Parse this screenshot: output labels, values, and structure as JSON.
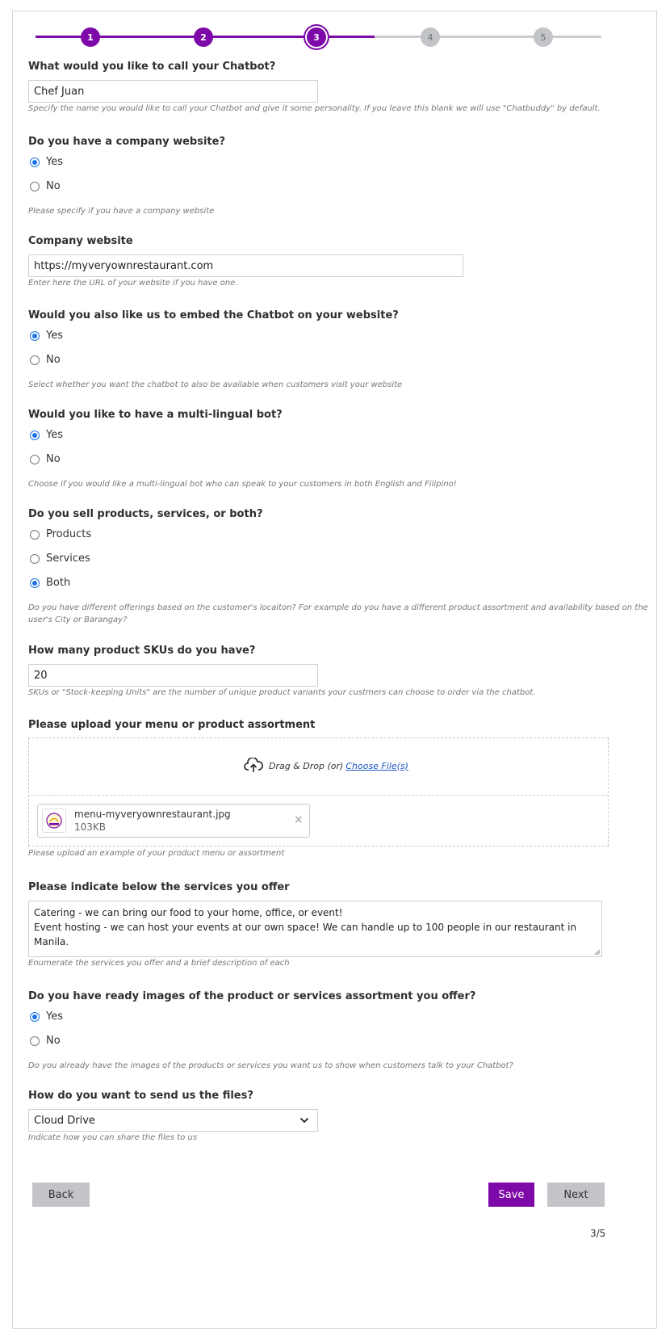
{
  "colors": {
    "accent": "#7d0aa8",
    "radio": "#1a73e8",
    "grey_button": "#c2c4c8"
  },
  "stepper": {
    "steps": [
      "1",
      "2",
      "3",
      "4",
      "5"
    ],
    "current": 3
  },
  "chatbot_name": {
    "label": "What would you like to call your Chatbot?",
    "value": "Chef Juan",
    "help": "Specify the name you would like to call your Chatbot and give it some personality. If you leave this blank we will use \"Chatbuddy\" by default."
  },
  "company_website_q": {
    "label": "Do you have a company website?",
    "options": [
      "Yes",
      "No"
    ],
    "selected": "Yes",
    "help": "Please specify if you have a company website"
  },
  "company_website": {
    "label": "Company website",
    "value": "https://myveryownrestaurant.com",
    "help": "Enter here the URL of your website if you have one."
  },
  "embed": {
    "label": "Would you also like us to embed the Chatbot on your website?",
    "options": [
      "Yes",
      "No"
    ],
    "selected": "Yes",
    "help": "Select whether you want the chatbot to also be available when customers visit your website"
  },
  "multilingual": {
    "label": "Would you like to have a multi-lingual bot?",
    "options": [
      "Yes",
      "No"
    ],
    "selected": "Yes",
    "help": "Choose if you would like a multi-lingual bot who can speak to your customers in both English and Filipino!"
  },
  "sell": {
    "label": "Do you sell products, services, or both?",
    "options": [
      "Products",
      "Services",
      "Both"
    ],
    "selected": "Both",
    "help_line1": "Do you have different offerings based on the customer's locaiton? For example do you have a different product assortment and availability based on the",
    "help_line2": "user's City or Barangay?"
  },
  "skus": {
    "label": "How many product SKUs do you have?",
    "value": "20",
    "help": "SKUs or \"Stock-keeping Units\" are the number of unique product variants your custmers can choose to order via the chatbot."
  },
  "upload": {
    "label": "Please upload your menu or product assortment",
    "drop_text": "Drag & Drop (or)",
    "choose_link": "Choose File(s)",
    "file_name": "menu-myveryownrestaurant.jpg",
    "file_size": "103KB",
    "remove_glyph": "×",
    "help": "Please upload an example of your product menu or assortment"
  },
  "services": {
    "label": "Please indicate below the services you offer",
    "line1": "Catering - we can bring our food to your home, office, or event!",
    "line2": "Event hosting - we can host your events at our own space! We can handle up to 100 people in our restaurant in Manila.",
    "help": "Enumerate the services you offer and a brief description of each"
  },
  "images": {
    "label": "Do you have ready images of the product or services assortment you offer?",
    "options": [
      "Yes",
      "No"
    ],
    "selected": "Yes",
    "help": "Do you already have the images of the products or services you want us to show when customers talk to your Chatbot?"
  },
  "send_files": {
    "label": "How do you want to send us the files?",
    "value": "Cloud Drive",
    "help": "Indicate how you can share the files to us"
  },
  "buttons": {
    "back": "Back",
    "save": "Save",
    "next": "Next"
  },
  "page_indicator": "3/5"
}
